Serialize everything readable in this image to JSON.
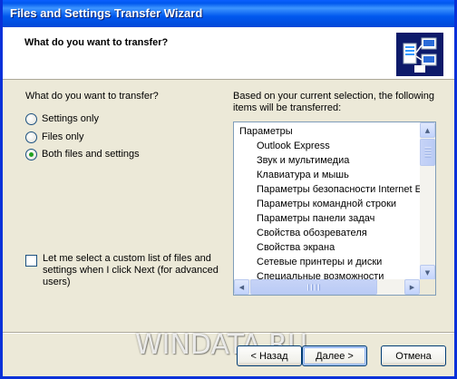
{
  "window": {
    "title": "Files and Settings Transfer Wizard"
  },
  "header": {
    "title": "What do you want to transfer?",
    "icon": "transfer-wizard-icon"
  },
  "left": {
    "question": "What do you want to transfer?",
    "options": [
      {
        "label": "Settings only",
        "selected": false
      },
      {
        "label": "Files only",
        "selected": false
      },
      {
        "label": "Both files and settings",
        "selected": true
      }
    ],
    "custom_checkbox": {
      "checked": false,
      "line1": "Let me select a custom list of files and",
      "line2": "settings when I click Next (for advanced",
      "line3": "users)"
    }
  },
  "right": {
    "intro_line1": "Based on your current selection, the following",
    "intro_line2": "items will be transferred:",
    "items": [
      {
        "label": "Параметры",
        "indent": 0
      },
      {
        "label": "Outlook Express",
        "indent": 1
      },
      {
        "label": "Звук и мультимедиа",
        "indent": 1
      },
      {
        "label": "Клавиатура и мышь",
        "indent": 1
      },
      {
        "label": "Параметры безопасности Internet E",
        "indent": 1
      },
      {
        "label": "Параметры командной строки",
        "indent": 1
      },
      {
        "label": "Параметры панели задач",
        "indent": 1
      },
      {
        "label": "Свойства обозревателя",
        "indent": 1
      },
      {
        "label": "Свойства экрана",
        "indent": 1
      },
      {
        "label": "Сетевые принтеры и диски",
        "indent": 1
      },
      {
        "label": "Специальные возможности",
        "indent": 1
      }
    ]
  },
  "buttons": {
    "back": "< Назад",
    "next": "Далее >",
    "cancel": "Отмена"
  },
  "watermark": "WINDATA.RU",
  "colors": {
    "titlebar": "#0058ee",
    "window_bg": "#ece9d8",
    "radio_dot": "#21a121",
    "border_accent": "#003c74"
  }
}
